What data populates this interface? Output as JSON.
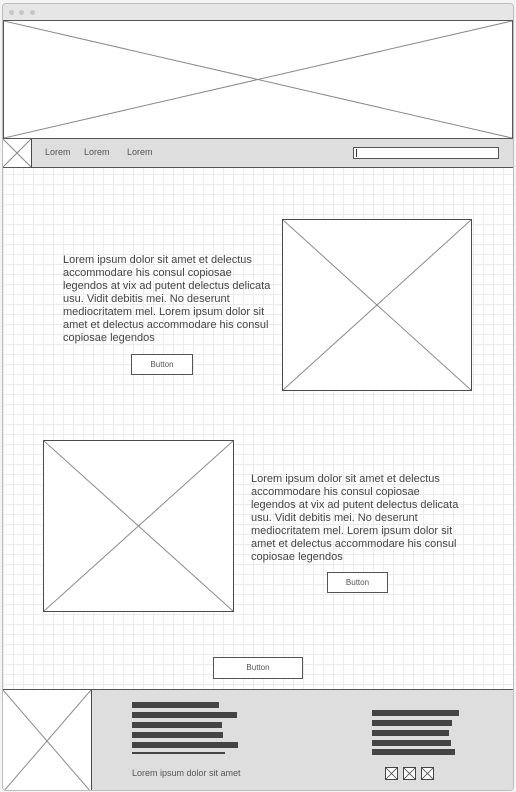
{
  "nav": {
    "links": [
      "Lorem",
      "Lorem",
      "Lorem"
    ],
    "search_value": ""
  },
  "sections": [
    {
      "text": "Lorem ipsum dolor sit amet et delectus accommodare his consul copiosae legendos at vix ad putent delectus delicata usu. Vidit debitis mei. No deserunt mediocritatem mel. Lorem ipsum dolor sit amet et delectus accommodare his consul copiosae legendos",
      "button": "Button"
    },
    {
      "text": "Lorem ipsum dolor sit amet et delectus accommodare his consul copiosae legendos at vix ad putent delectus delicata usu. Vidit debitis mei. No deserunt mediocritatem mel. Lorem ipsum dolor sit amet et delectus accommodare his consul copiosae legendos",
      "button": "Button"
    }
  ],
  "main_button": "Button",
  "footer": {
    "text": "Lorem ipsum dolor sit amet"
  }
}
